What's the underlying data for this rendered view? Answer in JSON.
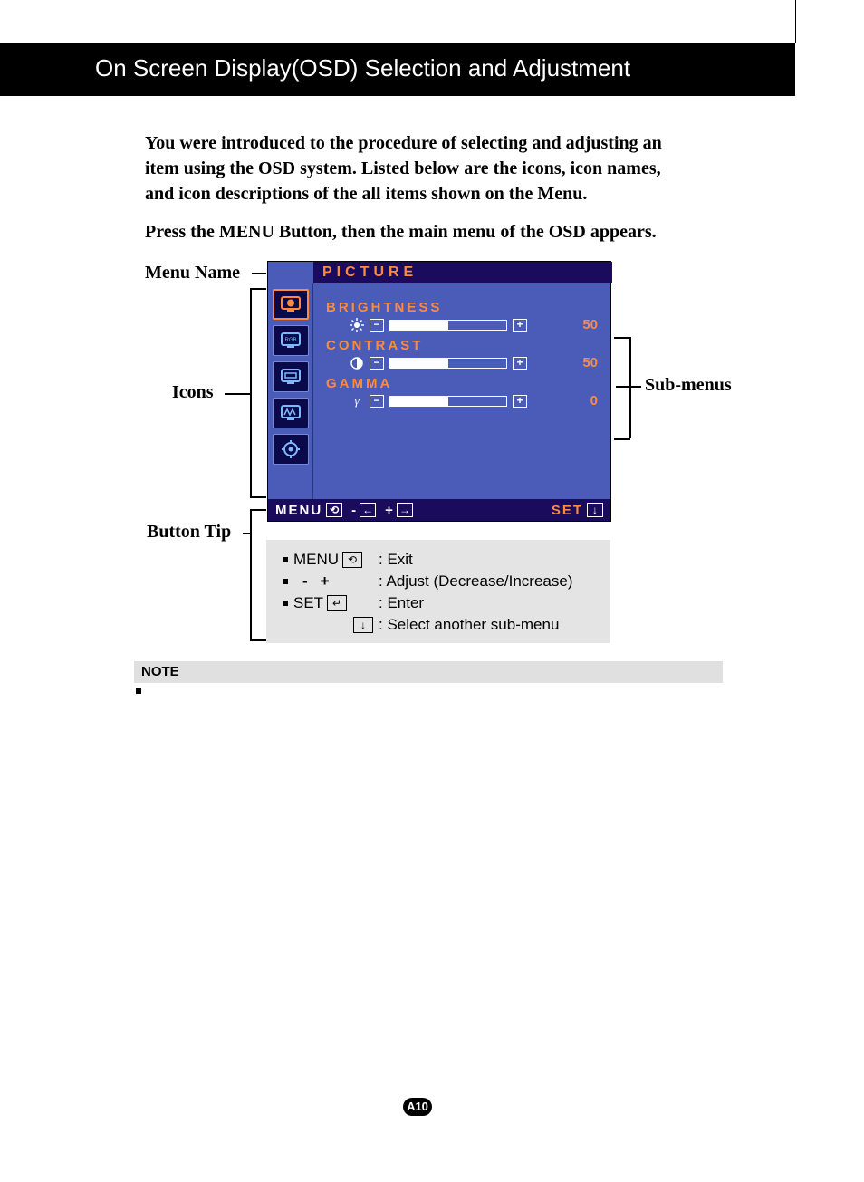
{
  "header": {
    "title": "On Screen Display(OSD) Selection and Adjustment"
  },
  "intro": {
    "p1": "You were introduced to the procedure of selecting and adjusting an item using the OSD system.  Listed below are the icons, icon names, and icon descriptions of the all items shown on the Menu.",
    "p2": "Press the MENU Button, then the main menu of the OSD appears."
  },
  "callouts": {
    "menu_name": "Menu Name",
    "icons": "Icons",
    "sub_menus": "Sub-menus",
    "button_tip": "Button Tip"
  },
  "osd": {
    "title": "PICTURE",
    "items": [
      {
        "label": "BRIGHTNESS",
        "value": "50",
        "fill_pct": 50,
        "icon": "sun"
      },
      {
        "label": "CONTRAST",
        "value": "50",
        "fill_pct": 50,
        "icon": "contrast"
      },
      {
        "label": "GAMMA",
        "value": "0",
        "fill_pct": 50,
        "icon": "gamma"
      }
    ],
    "footer": {
      "menu": "MENU",
      "minus": "-",
      "plus": "+",
      "set": "SET"
    }
  },
  "tips": {
    "r1_key": "MENU",
    "r1_desc": ": Exit",
    "r2_minus": "-",
    "r2_plus": "+",
    "r2_desc": ": Adjust (Decrease/Increase)",
    "r3_key": "SET",
    "r3_desc": ": Enter",
    "r4_desc": ": Select another sub-menu"
  },
  "note": {
    "label": "NOTE"
  },
  "page": {
    "num": "A10"
  }
}
